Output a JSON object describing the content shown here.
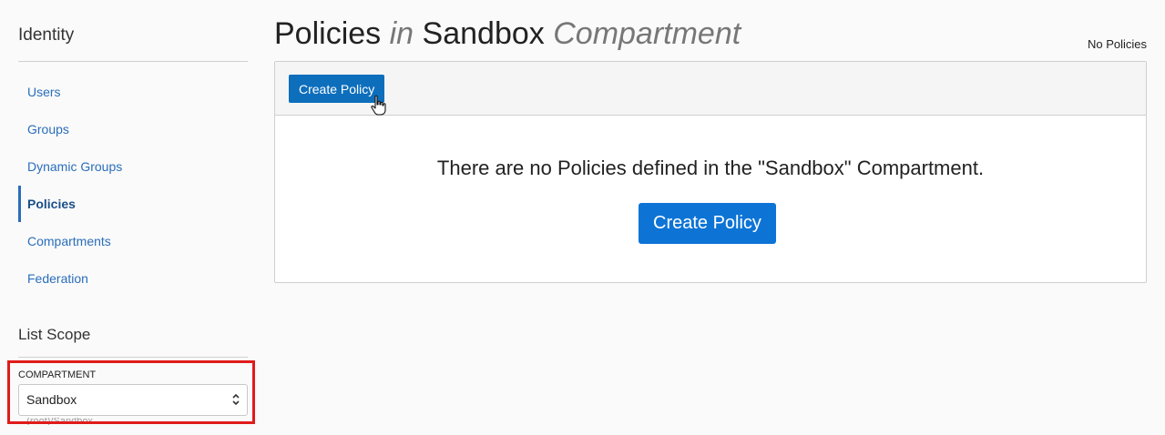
{
  "sidebar": {
    "title": "Identity",
    "items": [
      {
        "label": "Users"
      },
      {
        "label": "Groups"
      },
      {
        "label": "Dynamic Groups"
      },
      {
        "label": "Policies",
        "active": true
      },
      {
        "label": "Compartments"
      },
      {
        "label": "Federation"
      }
    ],
    "scope_title": "List Scope",
    "compartment_label": "COMPARTMENT",
    "compartment_value": "Sandbox",
    "compartment_path": "...(root)/Sandbox"
  },
  "main": {
    "title_prefix": "Policies",
    "title_in": "in",
    "title_name": "Sandbox",
    "title_suffix": "Compartment",
    "count_text": "No Policies",
    "toolbar_button": "Create Policy",
    "empty_message": "There are no Policies defined in the \"Sandbox\" Compartment.",
    "empty_button": "Create Policy"
  },
  "colors": {
    "link": "#2a6ebb",
    "primary_button": "#0d6ebc",
    "highlight": "#e01b1b"
  },
  "icons": [
    "select-chevron-icon",
    "hand-cursor-icon"
  ]
}
